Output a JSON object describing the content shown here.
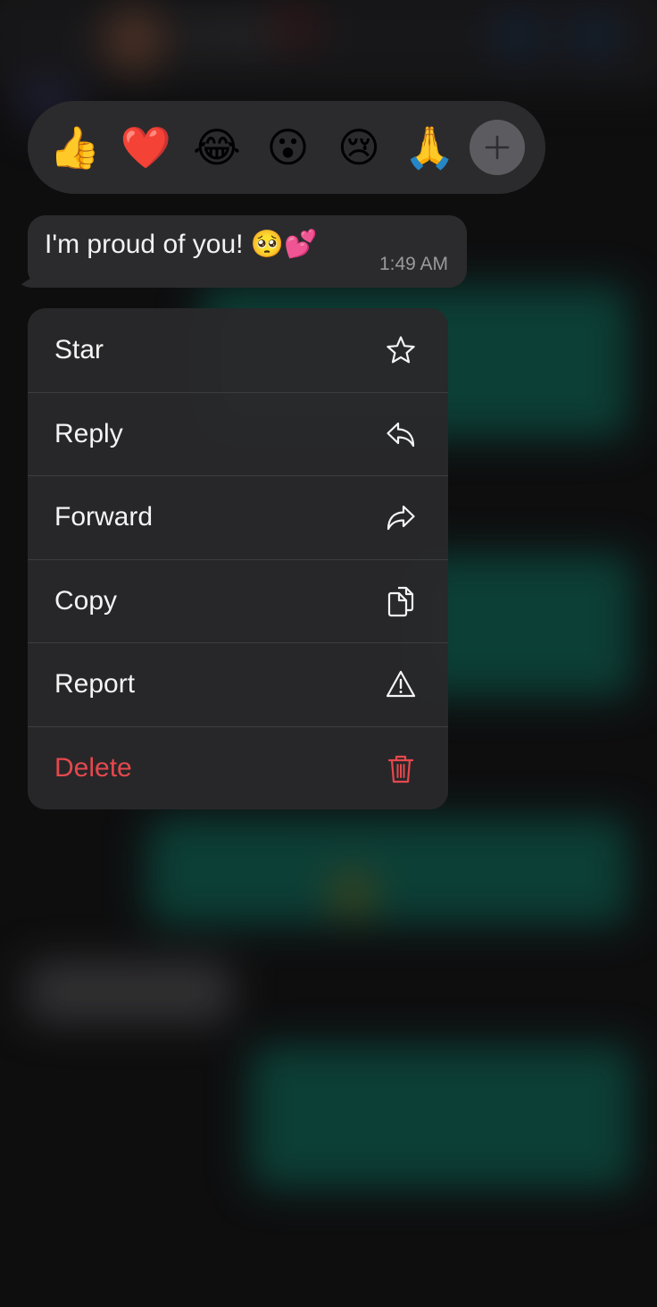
{
  "reactions": {
    "items": [
      {
        "name": "thumbs-up",
        "emoji": "👍"
      },
      {
        "name": "red-heart",
        "emoji": "❤️"
      },
      {
        "name": "tears-of-joy",
        "emoji": "😂"
      },
      {
        "name": "surprised",
        "emoji": "😮"
      },
      {
        "name": "crying",
        "emoji": "😢"
      },
      {
        "name": "folded-hands",
        "emoji": "🙏"
      }
    ],
    "more_icon": "plus-icon"
  },
  "message": {
    "text": "I'm proud of you! 🥺💕",
    "time": "1:49 AM"
  },
  "menu": {
    "items": [
      {
        "label": "Star",
        "icon": "star-icon",
        "color": "#ffffff"
      },
      {
        "label": "Reply",
        "icon": "reply-icon",
        "color": "#ffffff"
      },
      {
        "label": "Forward",
        "icon": "forward-icon",
        "color": "#ffffff"
      },
      {
        "label": "Copy",
        "icon": "copy-icon",
        "color": "#ffffff"
      },
      {
        "label": "Report",
        "icon": "warning-icon",
        "color": "#ffffff"
      },
      {
        "label": "Delete",
        "icon": "trash-icon",
        "color": "#e5484d"
      }
    ]
  },
  "colors": {
    "danger": "#e5484d",
    "surface": "#2b2b2d",
    "outgoing_bubble": "#0f4a40"
  }
}
